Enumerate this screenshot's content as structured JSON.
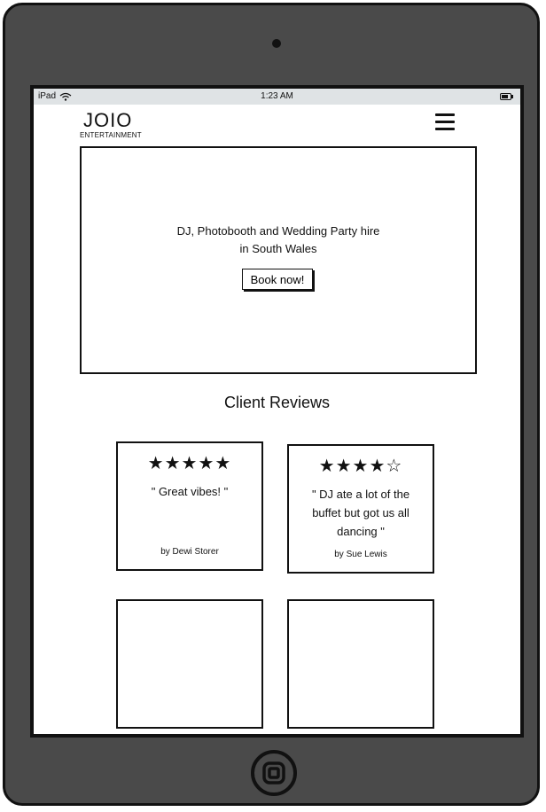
{
  "status_bar": {
    "device": "iPad",
    "time": "1:23 AM"
  },
  "header": {
    "logo_main": "JOIO",
    "logo_sub": "ENTERTAINMENT"
  },
  "hero": {
    "line1": "DJ, Photobooth and Wedding Party hire",
    "line2": "in South Wales",
    "button_label": "Book now!"
  },
  "reviews": {
    "title": "Client Reviews",
    "items": [
      {
        "stars": "★★★★★",
        "rating": 5,
        "quote": "\" Great vibes! \"",
        "author": "by Dewi Storer"
      },
      {
        "stars": "★★★★☆",
        "rating": 4,
        "quote": "\" DJ ate a lot of the buffet but got us all dancing \"",
        "author": "by Sue Lewis"
      }
    ]
  },
  "colors": {
    "device_body": "#4a4a4a",
    "status_bar": "#dfe3e5",
    "ink": "#111111"
  }
}
